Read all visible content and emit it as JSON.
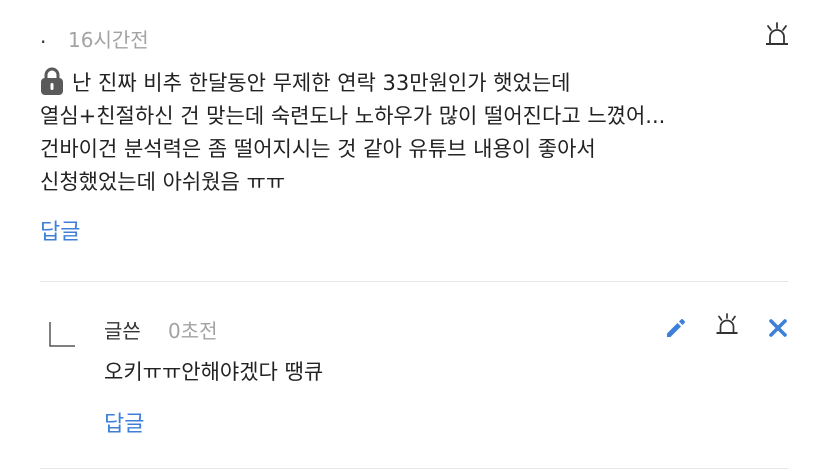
{
  "comment": {
    "author": ".",
    "time": "16시간전",
    "body_lines": [
      "난 진짜 비추 한달동안 무제한 연락 33만원인가 햇었는데",
      "열심+친절하신 건 맞는데 숙련도나 노하우가 많이 떨어진다고 느꼈어...",
      "건바이건 분석력은 좀 떨어지시는 것 같아 유튜브 내용이 좋아서",
      "신청했었는데 아쉬웠음 ㅠㅠ"
    ],
    "reply_label": "답글",
    "icons": {
      "lock": "lock-icon",
      "report": "siren-icon"
    }
  },
  "reply": {
    "author": "글쓴",
    "time": "0초전",
    "body": "오키ㅠㅠ안해야겠다 땡큐",
    "reply_label": "답글",
    "icons": {
      "edit": "pencil-icon",
      "report": "siren-icon",
      "delete": "close-icon"
    }
  },
  "colors": {
    "accent": "#3d7fd9",
    "muted": "#a3a3a3",
    "text": "#222222",
    "icon": "#333333"
  }
}
